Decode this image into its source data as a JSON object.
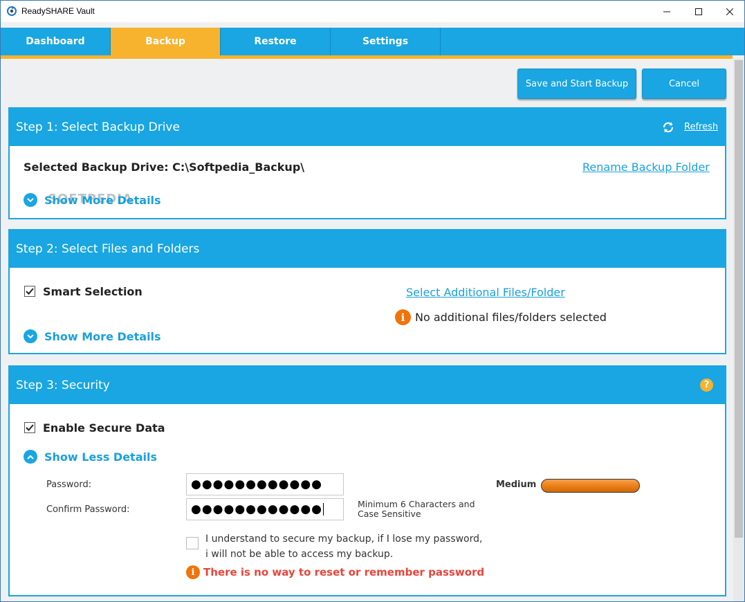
{
  "window": {
    "title": "ReadySHARE Vault"
  },
  "nav": {
    "tabs": [
      {
        "label": "Dashboard",
        "active": false
      },
      {
        "label": "Backup",
        "active": true
      },
      {
        "label": "Restore",
        "active": false
      },
      {
        "label": "Settings",
        "active": false
      }
    ]
  },
  "actions": {
    "save_label": "Save and Start Backup",
    "cancel_label": "Cancel"
  },
  "step1": {
    "title": "Step 1: Select Backup Drive",
    "refresh_label": "Refresh",
    "selected_drive": "Selected Backup Drive: C:\\Softpedia_Backup\\",
    "rename_label": "Rename Backup Folder",
    "show_more_label": "Show More Details",
    "watermark": "SOFTPEDIA"
  },
  "step2": {
    "title": "Step 2: Select Files and Folders",
    "smart_selection_label": "Smart Selection",
    "smart_selection_checked": true,
    "select_additional_label": "Select Additional Files/Folder",
    "no_additional_text": "No additional files/folders selected",
    "show_more_label": "Show More Details"
  },
  "step3": {
    "title": "Step 3: Security",
    "help_glyph": "?",
    "enable_secure_label": "Enable Secure Data",
    "enable_secure_checked": true,
    "show_less_label": "Show Less Details",
    "password_label": "Password:",
    "password_value": "●●●●●●●●●●●●",
    "confirm_label": "Confirm Password:",
    "confirm_value": "●●●●●●●●●●●●",
    "strength_label": "Medium",
    "hint_line1": "Minimum 6 Characters and",
    "hint_line2": "Case Sensitive",
    "understand_line1": "I understand to secure my backup, if I lose my password,",
    "understand_line2": "i will not be able to access my backup.",
    "understand_checked": false,
    "warning_text": "There is no way to reset or remember password"
  },
  "colors": {
    "accent": "#19a6e2",
    "active_tab": "#f7b32e",
    "warning": "#e8453c",
    "info": "#f0740a"
  }
}
